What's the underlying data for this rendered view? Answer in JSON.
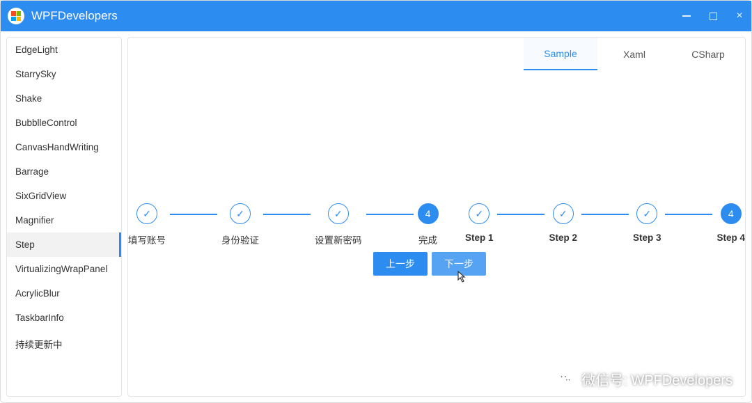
{
  "window": {
    "title": "WPFDevelopers"
  },
  "sidebar": {
    "items": [
      {
        "label": "EdgeLight"
      },
      {
        "label": "StarrySky"
      },
      {
        "label": "Shake"
      },
      {
        "label": "BubblleControl"
      },
      {
        "label": "CanvasHandWriting"
      },
      {
        "label": "Barrage"
      },
      {
        "label": "SixGridView"
      },
      {
        "label": "Magnifier"
      },
      {
        "label": "Step"
      },
      {
        "label": "VirtualizingWrapPanel"
      },
      {
        "label": "AcrylicBlur"
      },
      {
        "label": "TaskbarInfo"
      },
      {
        "label": "持续更新中"
      }
    ],
    "selected_index": 8
  },
  "tabs": {
    "items": [
      {
        "label": "Sample"
      },
      {
        "label": "Xaml"
      },
      {
        "label": "CSharp"
      }
    ],
    "active_index": 0
  },
  "steps_left": {
    "current_index": 3,
    "items": [
      {
        "label": "填写账号",
        "badge": "✓"
      },
      {
        "label": "身份验证",
        "badge": "✓"
      },
      {
        "label": "设置新密码",
        "badge": "✓"
      },
      {
        "label": "完成",
        "badge": "4"
      }
    ]
  },
  "steps_right": {
    "current_index": 3,
    "items": [
      {
        "label": "Step 1",
        "badge": "✓"
      },
      {
        "label": "Step 2",
        "badge": "✓"
      },
      {
        "label": "Step 3",
        "badge": "✓"
      },
      {
        "label": "Step 4",
        "badge": "4"
      }
    ]
  },
  "buttons": {
    "prev": "上一步",
    "next": "下一步"
  },
  "watermark": {
    "text": "微信号: WPFDevelopers"
  }
}
